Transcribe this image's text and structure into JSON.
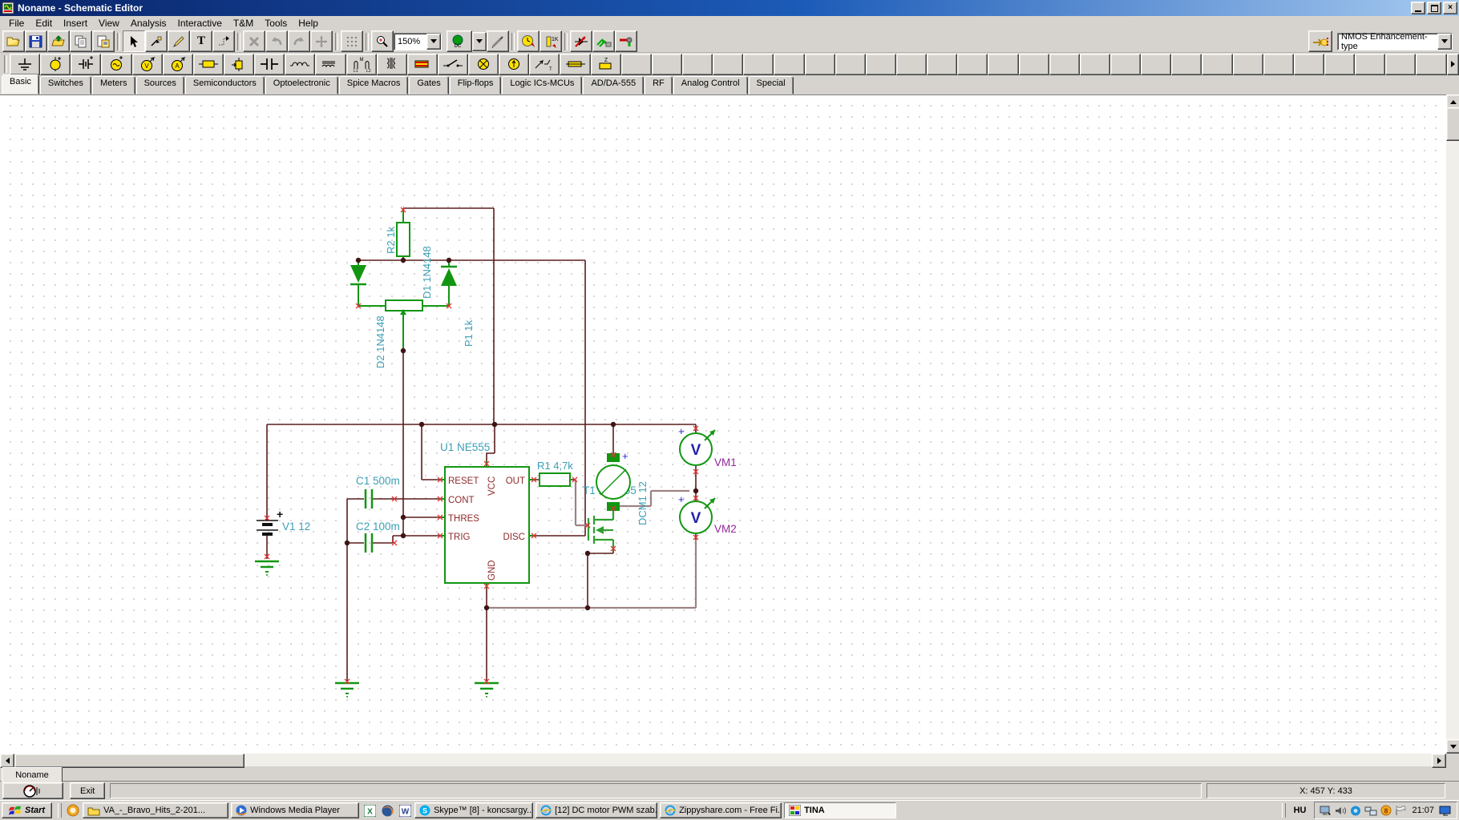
{
  "window": {
    "title": "Noname - Schematic Editor"
  },
  "menu": {
    "items": [
      "File",
      "Edit",
      "Insert",
      "View",
      "Analysis",
      "Interactive",
      "T&M",
      "Tools",
      "Help"
    ]
  },
  "toolbar": {
    "zoom_value": "150%",
    "dc_label": "DC",
    "text_tool_label": "T",
    "component_family": "NMOS Enhancement-type"
  },
  "tabs": [
    "Basic",
    "Switches",
    "Meters",
    "Sources",
    "Semiconductors",
    "Optoelectronic",
    "Spice Macros",
    "Gates",
    "Flip-flops",
    "Logic ICs-MCUs",
    "AD/DA-555",
    "RF",
    "Analog Control",
    "Special"
  ],
  "schematic": {
    "labels": {
      "r2": "R2 1k",
      "d1": "D1 1N4148",
      "d2": "D2 1N4148",
      "p1": "P1 1k",
      "u1": "U1 NE555",
      "r1": "R1 4,7k",
      "c1": "C1 500m",
      "c2": "C2 100m",
      "v1": "V1 12",
      "t1": "T1 2N6755",
      "motor": "DCM1 12",
      "vm1": "VM1",
      "vm2": "VM2",
      "plus": "+",
      "v_glyph": "V"
    },
    "pins": {
      "reset": "RESET",
      "cont": "CONT",
      "thres": "THRES",
      "trig": "TRIG",
      "vcc": "VCC",
      "gnd": "GND",
      "out": "OUT",
      "disc": "DISC"
    },
    "colors": {
      "wire": "#5b1d1d",
      "wire_light": "#9d8383",
      "component_green": "#129612",
      "value_label": "#3b9fb5",
      "pin_text": "#8f2a2a",
      "meter_label": "#93279b",
      "junction": "#401414",
      "pin_cross": "#e23333",
      "meter_v": "#2222aa"
    }
  },
  "doc_tab": "Noname",
  "exit_label": "Exit",
  "status": {
    "coords": "X: 457 Y: 433"
  },
  "taskbar": {
    "start": "Start",
    "buttons": [
      {
        "label": "VA_-_Bravo_Hits_2-201..."
      },
      {
        "label": "Windows Media Player"
      },
      {
        "label": "Skype™ [8] - koncsargy..."
      },
      {
        "label": "[12] DC motor PWM szab..."
      },
      {
        "label": "Zippyshare.com - Free Fi..."
      },
      {
        "label": "TINA"
      }
    ],
    "tray": {
      "lang": "HU",
      "clock": "21:07"
    }
  }
}
